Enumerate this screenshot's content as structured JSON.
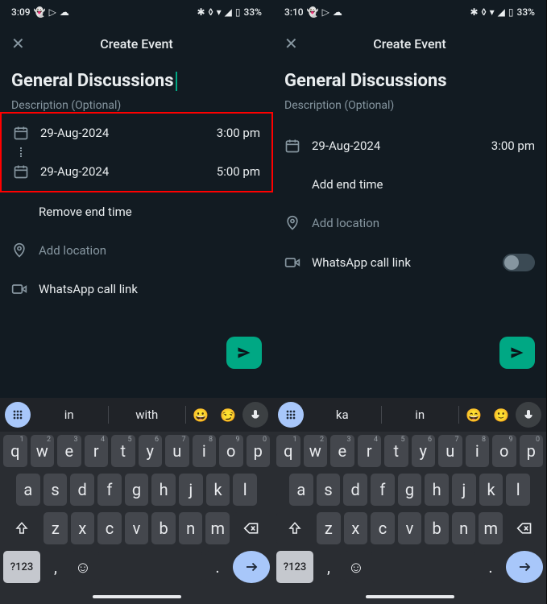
{
  "left": {
    "status": {
      "time": "3:09",
      "battery": "33%"
    },
    "title": "Create Event",
    "event_title": "General Discussions",
    "description_placeholder": "Description (Optional)",
    "start": {
      "date": "29-Aug-2024",
      "time": "3:00 pm"
    },
    "end": {
      "date": "29-Aug-2024",
      "time": "5:00 pm"
    },
    "remove_end_label": "Remove end time",
    "add_location_label": "Add location",
    "call_link_label": "WhatsApp call link",
    "suggestions": [
      "in",
      "with"
    ],
    "fab_bottom": "292px"
  },
  "right": {
    "status": {
      "time": "3:10",
      "battery": "33%"
    },
    "title": "Create Event",
    "event_title": "General Discussions",
    "description_placeholder": "Description (Optional)",
    "start": {
      "date": "29-Aug-2024",
      "time": "3:00 pm"
    },
    "add_end_label": "Add end time",
    "add_location_label": "Add location",
    "call_link_label": "WhatsApp call link",
    "suggestions": [
      "ka",
      "in"
    ],
    "fab_bottom": "292px"
  },
  "keyboard": {
    "row1": [
      "q",
      "w",
      "e",
      "r",
      "t",
      "y",
      "u",
      "i",
      "o",
      "p"
    ],
    "nums": [
      "1",
      "2",
      "3",
      "4",
      "5",
      "6",
      "7",
      "8",
      "9",
      "0"
    ],
    "row2": [
      "a",
      "s",
      "d",
      "f",
      "g",
      "h",
      "j",
      "k",
      "l"
    ],
    "row3": [
      "z",
      "x",
      "c",
      "v",
      "b",
      "n",
      "m"
    ],
    "sym": "?123",
    "comma": ",",
    "period": "."
  }
}
